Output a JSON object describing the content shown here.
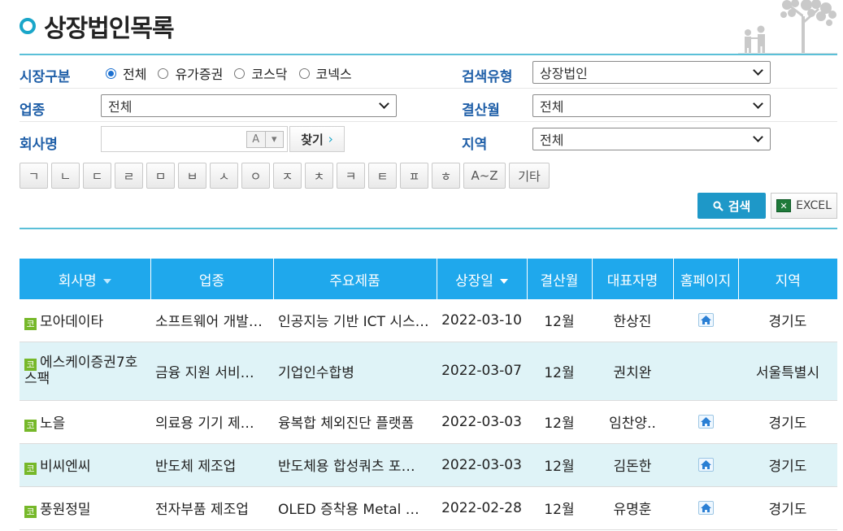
{
  "page": {
    "title": "상장법인목록"
  },
  "filters": {
    "market_label": "시장구분",
    "market_options": [
      {
        "label": "전체",
        "selected": true
      },
      {
        "label": "유가증권",
        "selected": false
      },
      {
        "label": "코스닥",
        "selected": false
      },
      {
        "label": "코넥스",
        "selected": false
      }
    ],
    "search_type_label": "검색유형",
    "search_type_value": "상장법인",
    "industry_label": "업종",
    "industry_value": "전체",
    "settlement_label": "결산월",
    "settlement_value": "전체",
    "company_label": "회사명",
    "company_value": "",
    "ime_mode": "A",
    "find_label": "찾기",
    "region_label": "지역",
    "region_value": "전체"
  },
  "jamo_buttons": [
    "ㄱ",
    "ㄴ",
    "ㄷ",
    "ㄹ",
    "ㅁ",
    "ㅂ",
    "ㅅ",
    "ㅇ",
    "ㅈ",
    "ㅊ",
    "ㅋ",
    "ㅌ",
    "ㅍ",
    "ㅎ",
    "A~Z",
    "기타"
  ],
  "actions": {
    "search_label": "검색",
    "excel_label": "EXCEL"
  },
  "table": {
    "columns": [
      "회사명",
      "업종",
      "주요제품",
      "상장일",
      "결산월",
      "대표자명",
      "홈페이지",
      "지역"
    ],
    "market_mark": "코",
    "rows": [
      {
        "company": "모아데이타",
        "industry": "소프트웨어 개발…",
        "product": "인공지능 기반 ICT 시스…",
        "listed": "2022-03-10",
        "settle": "12월",
        "ceo": "한상진",
        "homepage": true,
        "region": "경기도"
      },
      {
        "company": "에스케이증권7호스팩",
        "industry": "금융 지원 서비…",
        "product": "기업인수합병",
        "listed": "2022-03-07",
        "settle": "12월",
        "ceo": "권치완",
        "homepage": false,
        "region": "서울특별시"
      },
      {
        "company": "노을",
        "industry": "의료용 기기 제…",
        "product": "융복합 체외진단 플랫폼",
        "listed": "2022-03-03",
        "settle": "12월",
        "ceo": "임찬양..",
        "homepage": true,
        "region": "경기도"
      },
      {
        "company": "비씨엔씨",
        "industry": "반도체 제조업",
        "product": "반도체용 합성쿼츠 포…",
        "listed": "2022-03-03",
        "settle": "12월",
        "ceo": "김돈한",
        "homepage": true,
        "region": "경기도"
      },
      {
        "company": "풍원정밀",
        "industry": "전자부품 제조업",
        "product": "OLED 증착용 Metal …",
        "listed": "2022-02-28",
        "settle": "12월",
        "ceo": "유명훈",
        "homepage": true,
        "region": "경기도"
      }
    ]
  },
  "colors": {
    "accent": "#1fa8ec",
    "label": "#1f5fa8",
    "row_alt": "#dff3f7",
    "market_mark": "#76b82a"
  }
}
